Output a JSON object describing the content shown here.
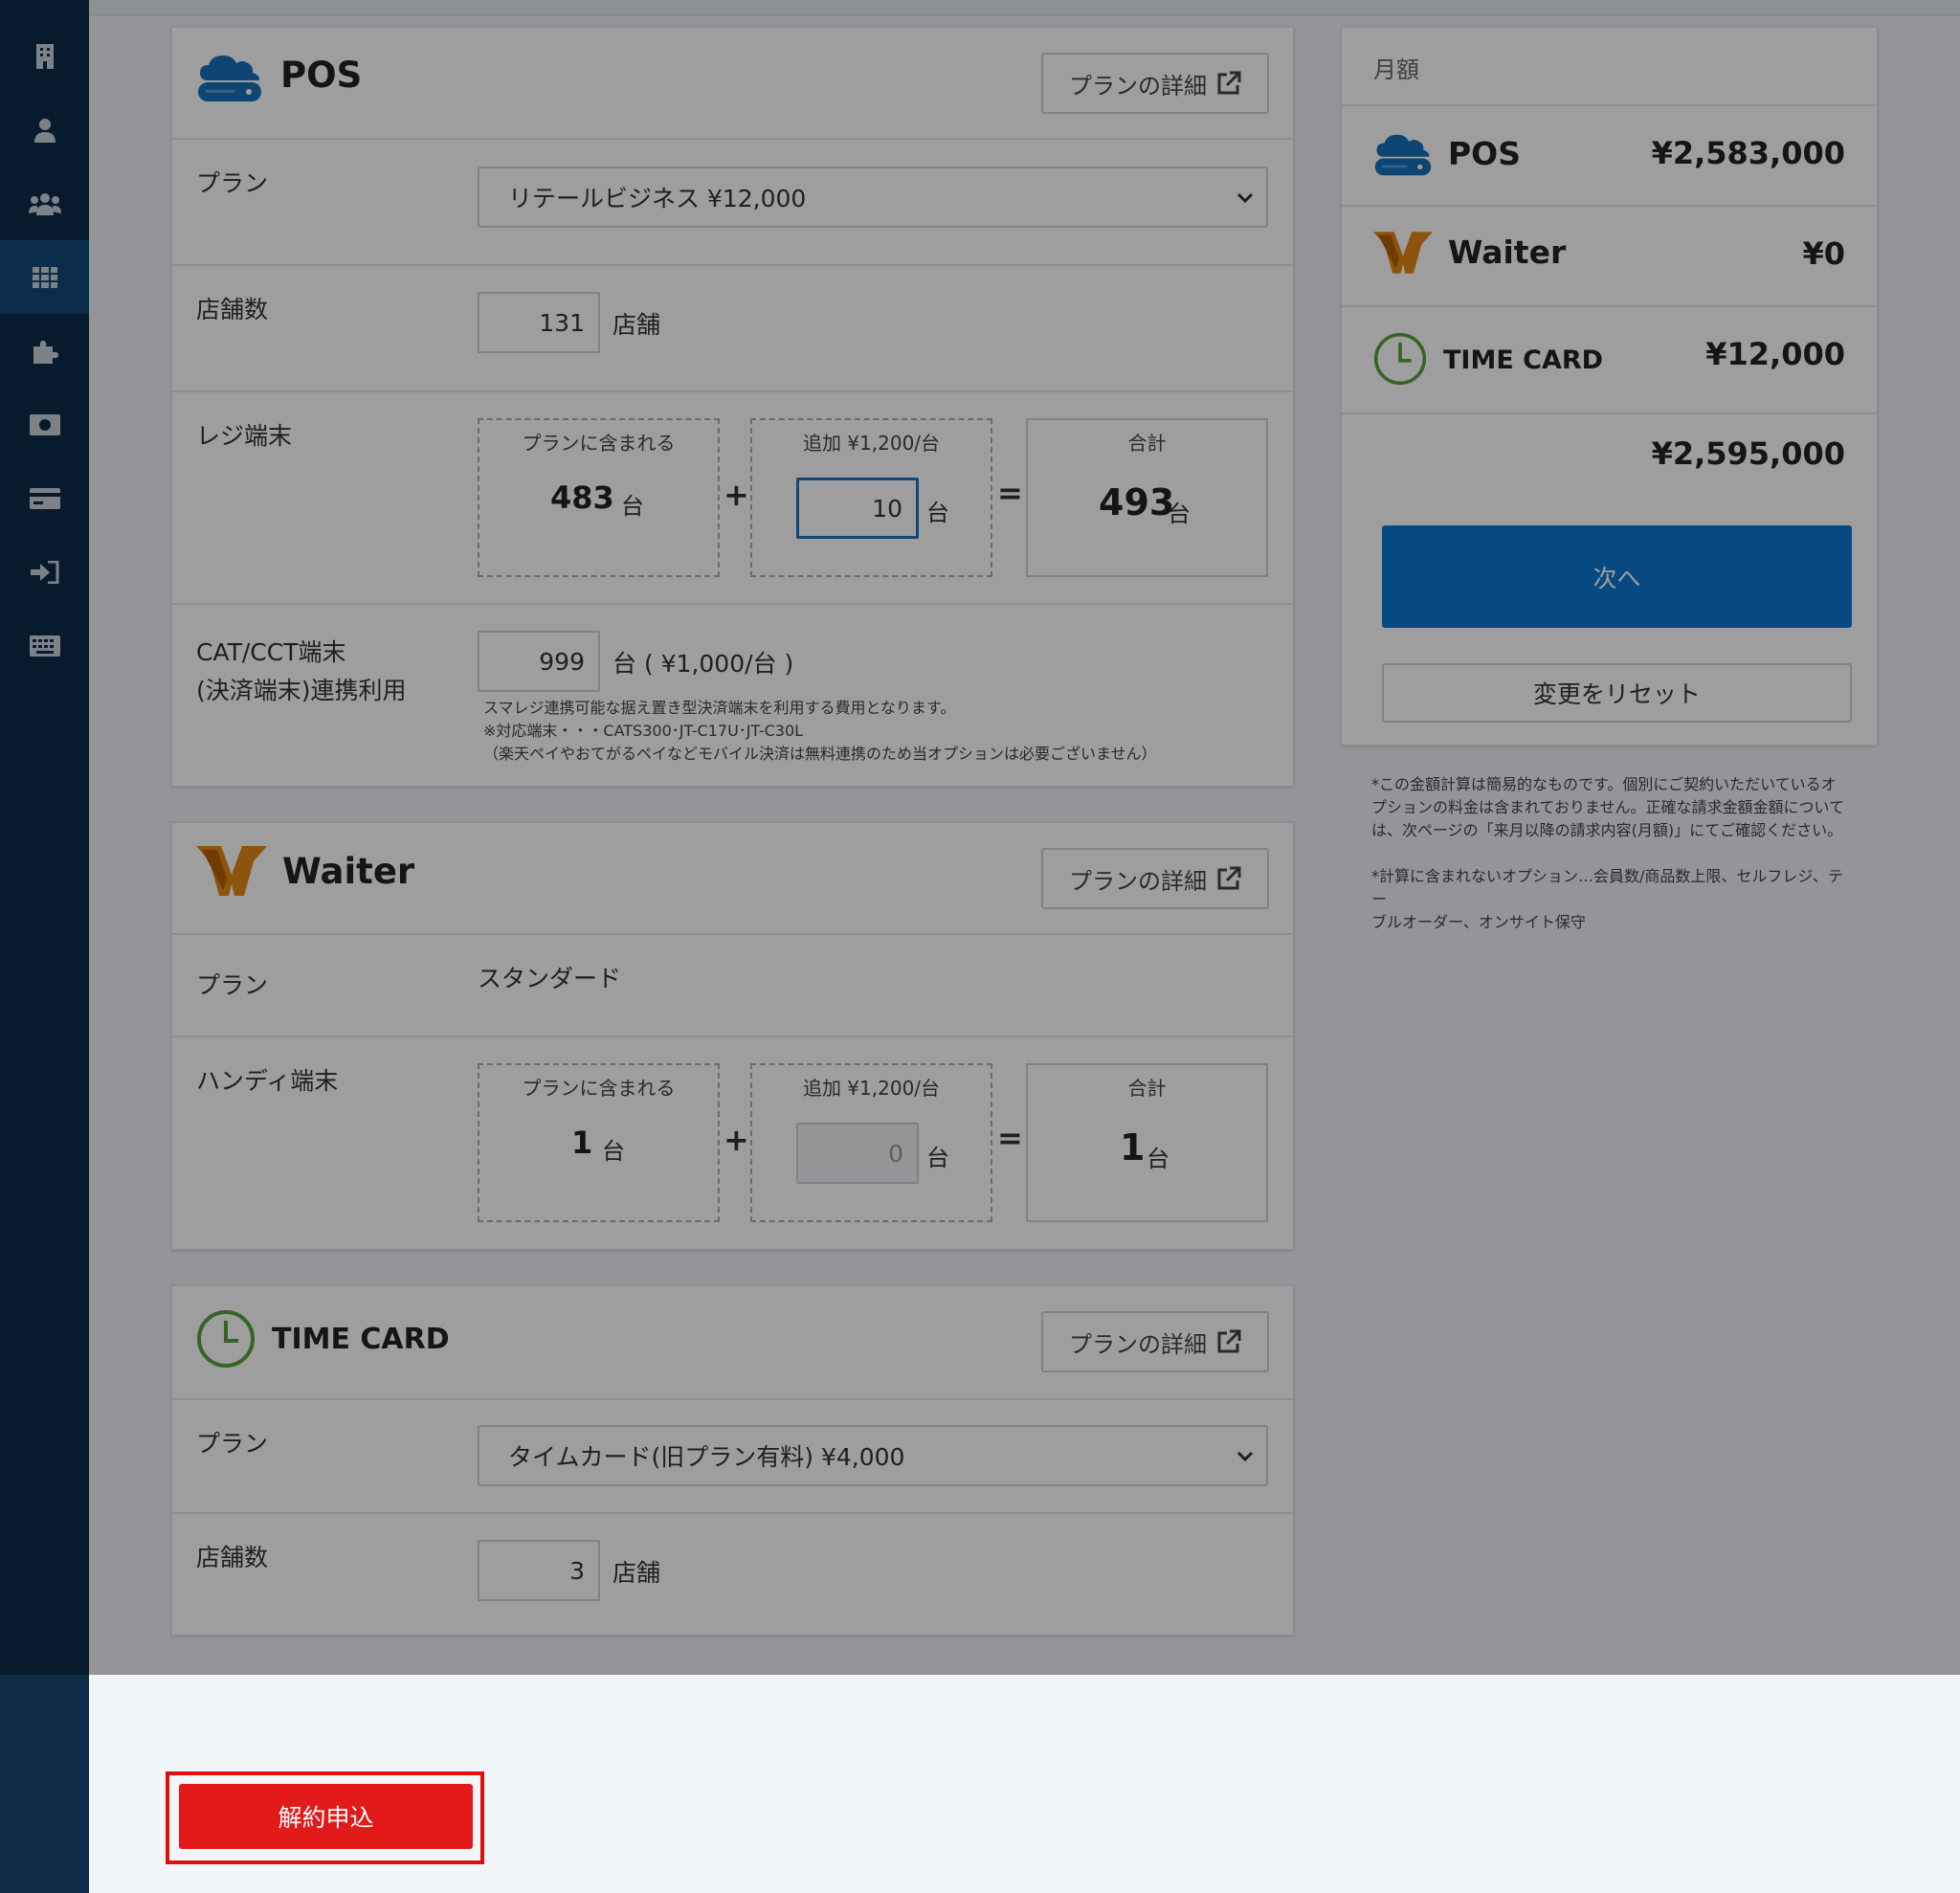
{
  "pos": {
    "title": "POS",
    "detail_label": "プランの詳細",
    "plan_label": "プラン",
    "plan_value": "リテールビジネス ¥12,000",
    "stores_label": "店舗数",
    "stores_value": "131",
    "stores_unit": "店舗",
    "register_label": "レジ端末",
    "included_title": "プランに含まれる",
    "included_value": "483",
    "unit": "台",
    "additional_title": "追加 ¥1,200/台",
    "additional_value": "10",
    "total_title": "合計",
    "total_value": "493",
    "plus": "+",
    "equals": "=",
    "cat_label_line1": "CAT/CCT端末",
    "cat_label_line2": "(決済端末)連携利用",
    "cat_value": "999",
    "cat_unit": "台 ( ¥1,000/台 )",
    "cat_note_1": "スマレジ連携可能な据え置き型決済端末を利用する費用となります。",
    "cat_note_2": "※対応端末・・・CATS300･JT-C17U･JT-C30L",
    "cat_note_3": "（楽天ペイやおてがるペイなどモバイル決済は無料連携のため当オプションは必要ございません）"
  },
  "waiter": {
    "title": "Waiter",
    "detail_label": "プランの詳細",
    "plan_label": "プラン",
    "plan_value": "スタンダード",
    "handy_label": "ハンディ端末",
    "included_title": "プランに含まれる",
    "included_value": "1",
    "unit": "台",
    "additional_title": "追加 ¥1,200/台",
    "additional_value": "0",
    "total_title": "合計",
    "total_value": "1",
    "plus": "+",
    "equals": "="
  },
  "timecard": {
    "title": "TIME CARD",
    "detail_label": "プランの詳細",
    "plan_label": "プラン",
    "plan_value": "タイムカード(旧プラン有料) ¥4,000",
    "stores_label": "店舗数",
    "stores_value": "3",
    "stores_unit": "店舗"
  },
  "summary": {
    "header": "月額",
    "pos_name": "POS",
    "pos_price": "¥2,583,000",
    "waiter_name": "Waiter",
    "waiter_price": "¥0",
    "timecard_name": "TIME CARD",
    "timecard_price": "¥12,000",
    "total": "¥2,595,000",
    "next_label": "次へ",
    "reset_label": "変更をリセット",
    "note_1a": "*この金額計算は簡易的なものです。個別にご契約いただいているオ",
    "note_1b": "プションの料金は含まれておりません。正確な請求金額金額について",
    "note_1c": "は、次ページの「来月以降の請求内容(月額)」にてご確認ください。",
    "note_2a": "*計算に含まれないオプション…会員数/商品数上限、セルフレジ、テー",
    "note_2b": "ブルオーダー、オンサイト保守"
  },
  "footer": {
    "cancel_label": "解約申込"
  },
  "colors": {
    "sidebar": "#0e2c47",
    "sidebar_active": "#124a78",
    "primary": "#0b78d0",
    "danger": "#e21a1a",
    "pos_blue": "#1672b8",
    "waiter_orange": "#e48a12",
    "timecard_green": "#5aa03c"
  },
  "sidebar_icons": [
    "building-icon",
    "user-icon",
    "users-icon",
    "grid-icon",
    "puzzle-icon",
    "money-icon",
    "card-icon",
    "sign-in-icon",
    "keyboard-icon"
  ]
}
